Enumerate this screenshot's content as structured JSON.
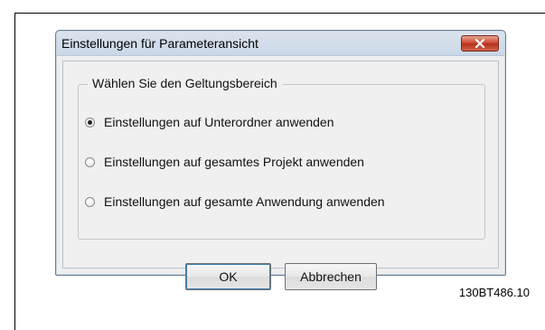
{
  "dialog": {
    "title": "Einstellungen für Parameteransicht",
    "close_icon": "close-icon"
  },
  "group": {
    "legend": "Wählen Sie den Geltungsbereich",
    "options": [
      {
        "label": "Einstellungen auf Unterordner anwenden",
        "selected": true
      },
      {
        "label": "Einstellungen auf gesamtes Projekt anwenden",
        "selected": false
      },
      {
        "label": "Einstellungen auf gesamte Anwendung anwenden",
        "selected": false
      }
    ]
  },
  "buttons": {
    "ok_label": "OK",
    "cancel_label": "Abbrechen"
  },
  "figure": {
    "code": "130BT486.10"
  },
  "colors": {
    "close_button": "#c8432c",
    "titlebar": "#c9d7e6",
    "dialog_face": "#f0f0f0"
  }
}
